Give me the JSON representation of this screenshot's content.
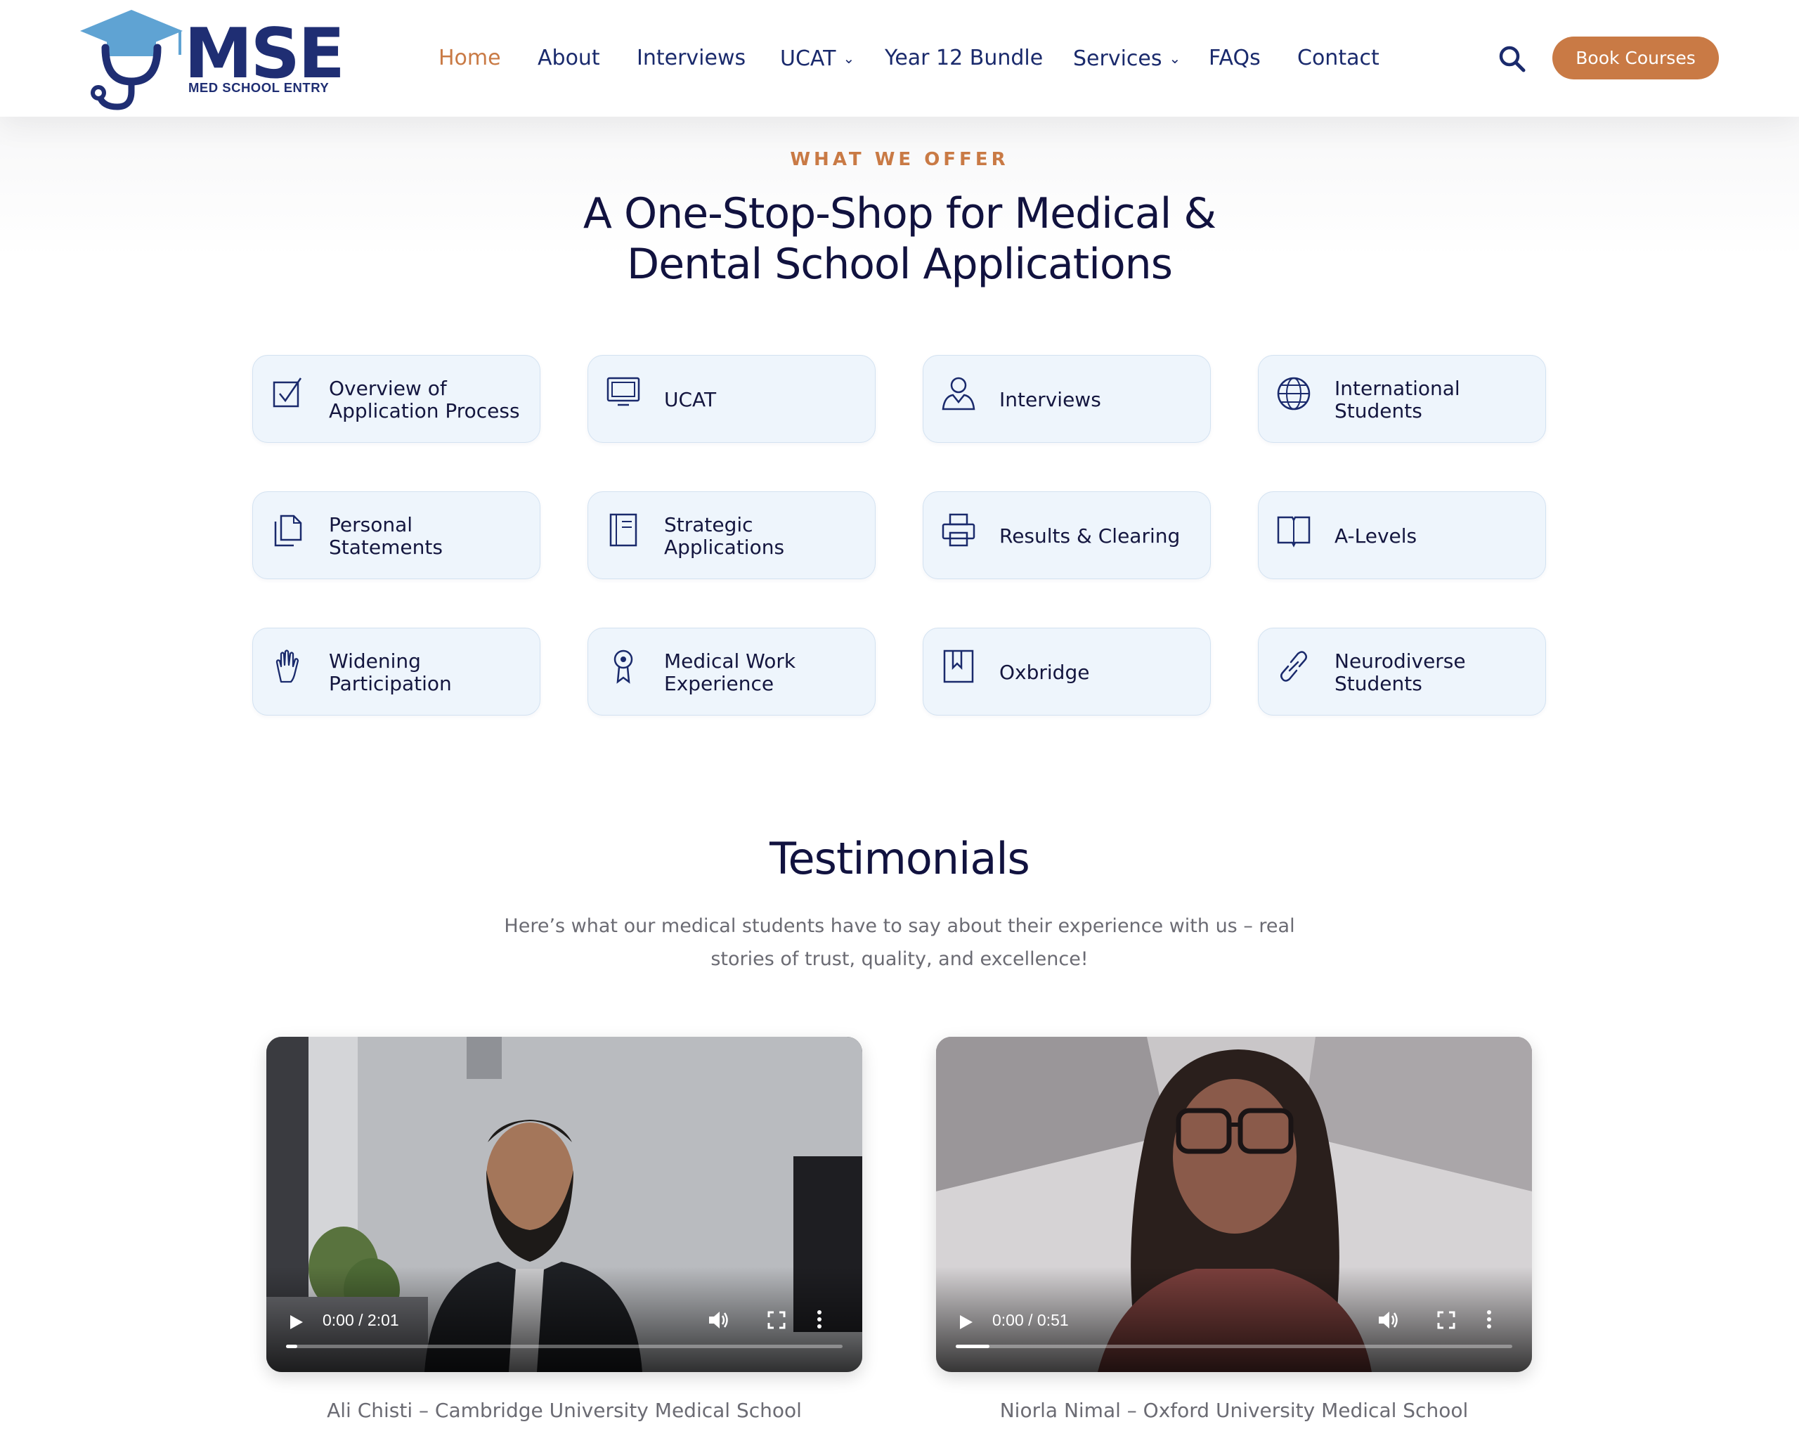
{
  "brand": {
    "name": "MSE",
    "tagline": "MED SCHOOL ENTRY"
  },
  "colors": {
    "accent": "#c97a45",
    "navy": "#1a2a6c",
    "logo_cap": "#5fa3d3",
    "card_bg": "#eef5fc"
  },
  "nav": {
    "items": [
      {
        "label": "Home",
        "active": true,
        "dropdown": false
      },
      {
        "label": "About",
        "active": false,
        "dropdown": false
      },
      {
        "label": "Interviews",
        "active": false,
        "dropdown": false
      },
      {
        "label": "UCAT",
        "active": false,
        "dropdown": true
      },
      {
        "label": "Year 12 Bundle",
        "active": false,
        "dropdown": false
      },
      {
        "label": "Services",
        "active": false,
        "dropdown": true
      },
      {
        "label": "FAQs",
        "active": false,
        "dropdown": false
      },
      {
        "label": "Contact",
        "active": false,
        "dropdown": false
      }
    ],
    "search_icon": "search-icon",
    "cta_label": "Book Courses"
  },
  "offer": {
    "eyebrow": "WHAT WE OFFER",
    "headline_line1": "A One-Stop-Shop for Medical &",
    "headline_line2": "Dental School Applications",
    "cards": [
      {
        "label_line1": "Overview of",
        "label_line2": "Application Process",
        "icon": "checkbox-icon"
      },
      {
        "label_line1": "UCAT",
        "label_line2": "",
        "icon": "monitor-icon"
      },
      {
        "label_line1": "Interviews",
        "label_line2": "",
        "icon": "person-icon"
      },
      {
        "label_line1": "International",
        "label_line2": "Students",
        "icon": "globe-icon"
      },
      {
        "label_line1": "Personal",
        "label_line2": "Statements",
        "icon": "documents-icon"
      },
      {
        "label_line1": "Strategic",
        "label_line2": "Applications",
        "icon": "notebook-icon"
      },
      {
        "label_line1": "Results & Clearing",
        "label_line2": "",
        "icon": "printer-icon"
      },
      {
        "label_line1": "A-Levels",
        "label_line2": "",
        "icon": "open-book-icon"
      },
      {
        "label_line1": "Widening",
        "label_line2": "Participation",
        "icon": "hand-icon"
      },
      {
        "label_line1": "Medical Work",
        "label_line2": "Experience",
        "icon": "award-ribbon-icon"
      },
      {
        "label_line1": "Oxbridge",
        "label_line2": "",
        "icon": "bookmark-icon"
      },
      {
        "label_line1": "Neurodiverse",
        "label_line2": "Students",
        "icon": "link-icon"
      }
    ]
  },
  "testimonials": {
    "title": "Testimonials",
    "subtitle_line1": "Here’s what our medical students have to say about their experience with us – real",
    "subtitle_line2": "stories of trust, quality, and excellence!",
    "videos": [
      {
        "time": "0:00 / 2:01",
        "progress": 0.02,
        "caption": "Ali Chisti – Cambridge University Medical School"
      },
      {
        "time": "0:00 / 0:51",
        "progress": 0.06,
        "caption": "Niorla Nimal – Oxford University Medical School"
      }
    ]
  }
}
